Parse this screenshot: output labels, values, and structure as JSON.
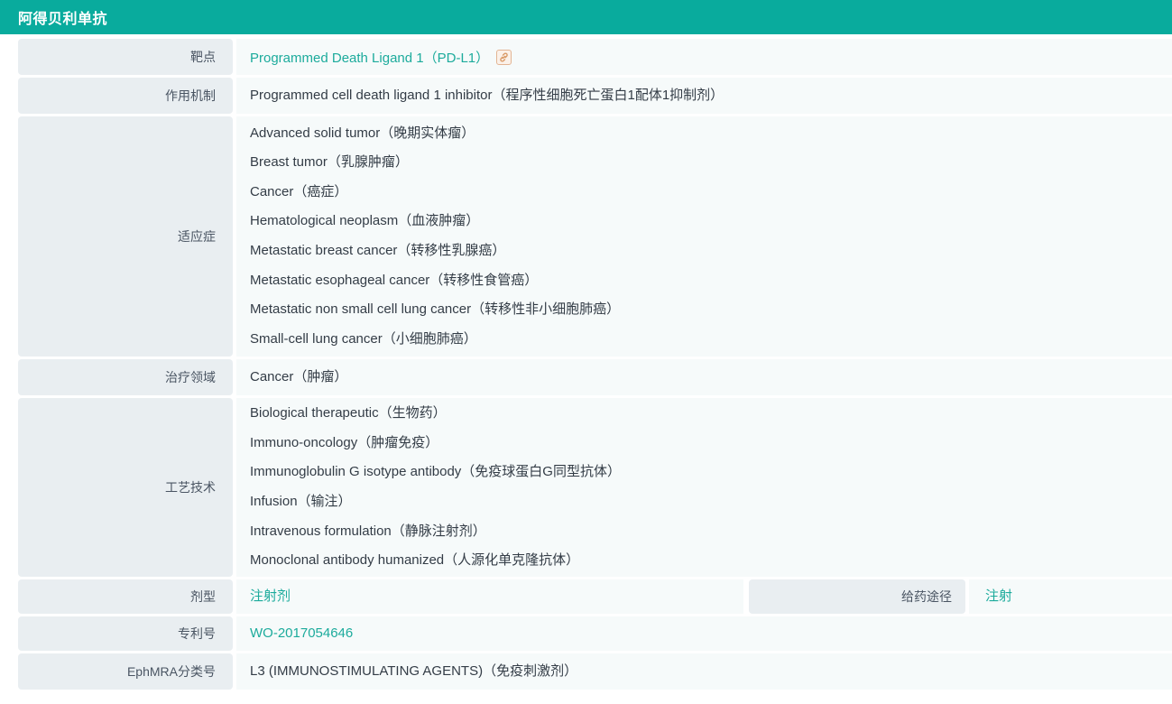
{
  "header": {
    "title": "阿得贝利单抗"
  },
  "colors": {
    "header_bg": "#09AB9D",
    "link": "#1CAB9C",
    "label_bg": "#E9EEF1",
    "value_bg": "#F6FAFA"
  },
  "icons": {
    "target_link": "external-link-icon"
  },
  "rows": {
    "target": {
      "label": "靶点",
      "value": "Programmed Death Ligand 1（PD-L1）"
    },
    "mechanism": {
      "label": "作用机制",
      "value": "Programmed cell death ligand 1 inhibitor（程序性细胞死亡蛋白1配体1抑制剂）"
    },
    "indications": {
      "label": "适应症",
      "items": [
        "Advanced solid tumor（晚期实体瘤）",
        "Breast tumor（乳腺肿瘤）",
        "Cancer（癌症）",
        "Hematological neoplasm（血液肿瘤）",
        "Metastatic breast cancer（转移性乳腺癌）",
        "Metastatic esophageal cancer（转移性食管癌）",
        "Metastatic non small cell lung cancer（转移性非小细胞肺癌）",
        "Small-cell lung cancer（小细胞肺癌）"
      ]
    },
    "therapy_area": {
      "label": "治疗领域",
      "value": "Cancer（肿瘤）"
    },
    "technology": {
      "label": "工艺技术",
      "items": [
        "Biological therapeutic（生物药）",
        "Immuno-oncology（肿瘤免疫）",
        "Immunoglobulin G isotype antibody（免疫球蛋白G同型抗体）",
        "Infusion（输注）",
        "Intravenous formulation（静脉注射剂）",
        "Monoclonal antibody humanized（人源化单克隆抗体）"
      ]
    },
    "dosage_form": {
      "label": "剂型",
      "value": "注射剂"
    },
    "route": {
      "label": "给药途径",
      "value": "注射"
    },
    "patent": {
      "label": "专利号",
      "value": "WO-2017054646"
    },
    "ephmra": {
      "label": "EphMRA分类号",
      "value": "L3 (IMMUNOSTIMULATING AGENTS)（免疫刺激剂）"
    }
  }
}
